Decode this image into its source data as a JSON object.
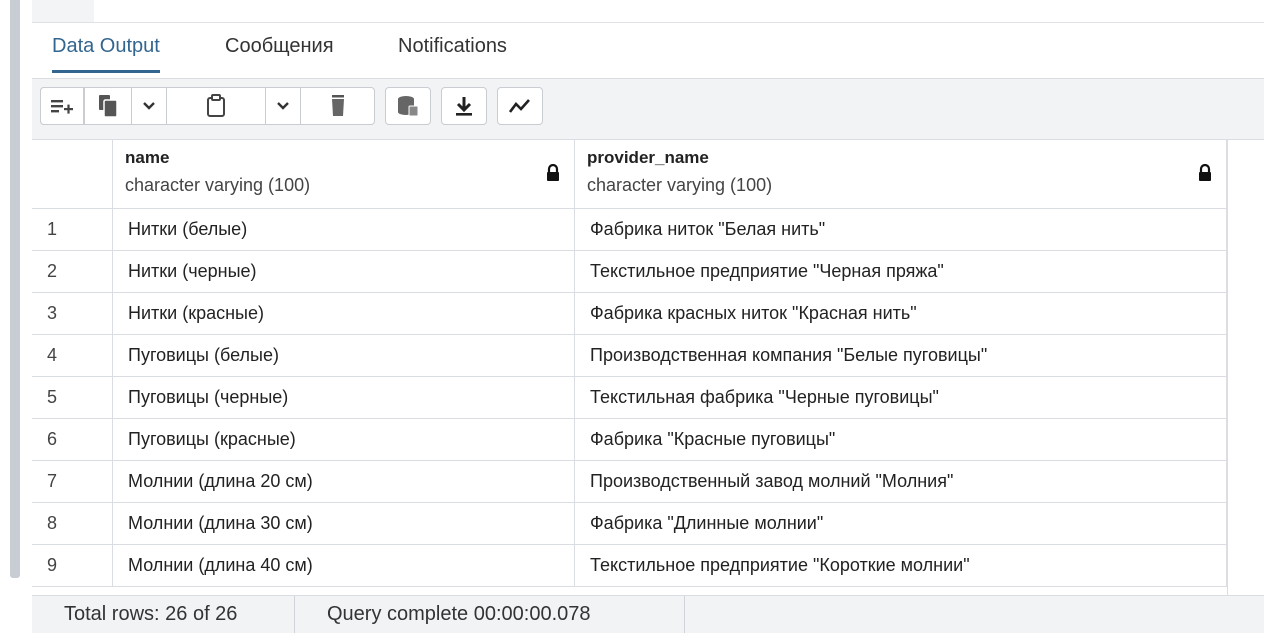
{
  "tabs": [
    {
      "label": "Data Output"
    },
    {
      "label": "Сообщения"
    },
    {
      "label": "Notifications"
    }
  ],
  "toolbar": {
    "icons": [
      "add-row-icon",
      "copy-icon",
      "chevron-down-icon",
      "paste-icon",
      "chevron-down-icon",
      "delete-icon",
      "save-data-icon",
      "download-icon",
      "graph-icon"
    ]
  },
  "columns": [
    {
      "name": "name",
      "type": "character varying (100)"
    },
    {
      "name": "provider_name",
      "type": "character varying (100)"
    }
  ],
  "rows": [
    {
      "num": "1",
      "name": "Нитки (белые)",
      "provider": "Фабрика ниток \"Белая нить\""
    },
    {
      "num": "2",
      "name": "Нитки (черные)",
      "provider": "Текстильное предприятие \"Черная пряжа\""
    },
    {
      "num": "3",
      "name": "Нитки (красные)",
      "provider": "Фабрика красных ниток \"Красная нить\""
    },
    {
      "num": "4",
      "name": "Пуговицы (белые)",
      "provider": "Производственная компания \"Белые пуговицы\""
    },
    {
      "num": "5",
      "name": "Пуговицы (черные)",
      "provider": "Текстильная фабрика \"Черные пуговицы\""
    },
    {
      "num": "6",
      "name": "Пуговицы (красные)",
      "provider": "Фабрика \"Красные пуговицы\""
    },
    {
      "num": "7",
      "name": "Молнии (длина 20 см)",
      "provider": "Производственный завод молний \"Молния\""
    },
    {
      "num": "8",
      "name": "Молнии (длина 30 см)",
      "provider": "Фабрика \"Длинные молнии\""
    },
    {
      "num": "9",
      "name": "Молнии (длина 40 см)",
      "provider": "Текстильное предприятие \"Короткие молнии\""
    }
  ],
  "status": {
    "total_rows": "Total rows: 26 of 26",
    "query": "Query complete 00:00:00.078"
  },
  "colors": {
    "accent": "#326690",
    "toolbar_bg": "#f2f3f5",
    "border": "#dadde2"
  }
}
